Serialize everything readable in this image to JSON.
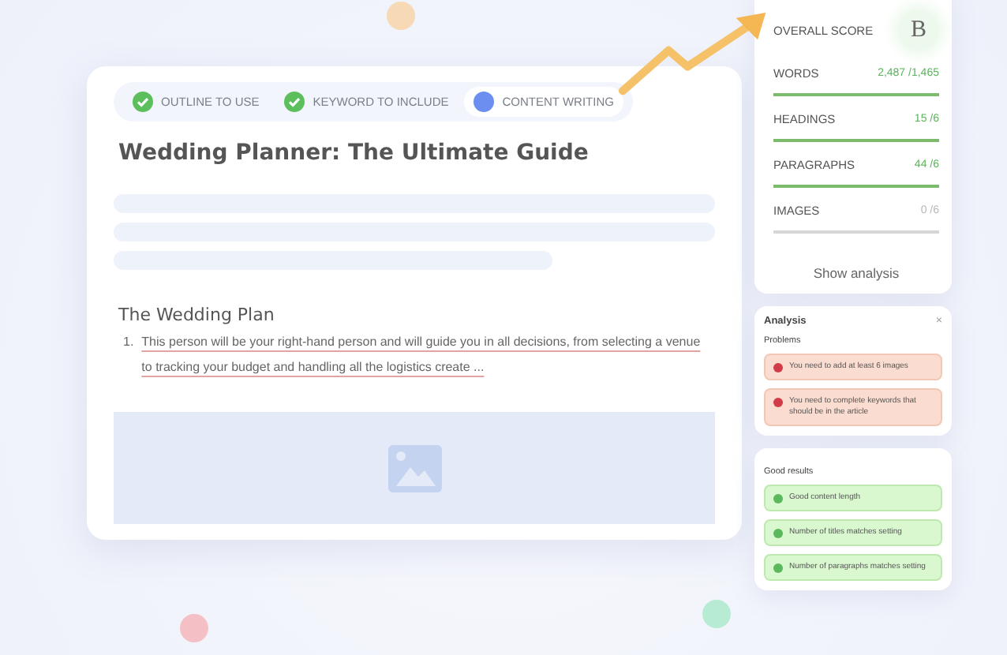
{
  "steps": [
    {
      "label": "OUTLINE TO USE",
      "done": true,
      "selected": false
    },
    {
      "label": "KEYWORD TO INCLUDE",
      "done": true,
      "selected": false
    },
    {
      "label": "CONTENT WRITING",
      "done": false,
      "selected": true
    }
  ],
  "editor": {
    "title": "Wedding Planner: The Ultimate Guide",
    "heading": "The Wedding Plan",
    "list": [
      {
        "number": "1.",
        "text": "This person will be your right-hand person and will guide you in all decisions, from selecting a venue to tracking your budget and handling all the logistics create ..."
      }
    ]
  },
  "score": {
    "label": "OVERALL SCORE",
    "grade": "B",
    "metrics": [
      {
        "label": "WORDS",
        "value": "2,487 /1,465",
        "met": true
      },
      {
        "label": "HEADINGS",
        "value": "15 /6",
        "met": true
      },
      {
        "label": "PARAGRAPHS",
        "value": "44 /6",
        "met": true
      },
      {
        "label": "IMAGES",
        "value": "0 /6",
        "met": false
      }
    ],
    "link": "Show analysis"
  },
  "analysis": {
    "title": "Analysis",
    "close": "×",
    "sections": [
      {
        "title": "Problems",
        "items": [
          {
            "kind": "problem",
            "text": "You need to add at least 6 images"
          },
          {
            "kind": "problem",
            "text": "You need to complete keywords that should be in the article"
          }
        ]
      },
      {
        "title": "Good results",
        "items": [
          {
            "kind": "good",
            "text": "Good content length"
          },
          {
            "kind": "good",
            "text": "Number of titles matches setting"
          },
          {
            "kind": "good",
            "text": "Number of paragraphs matches setting"
          }
        ]
      }
    ]
  }
}
